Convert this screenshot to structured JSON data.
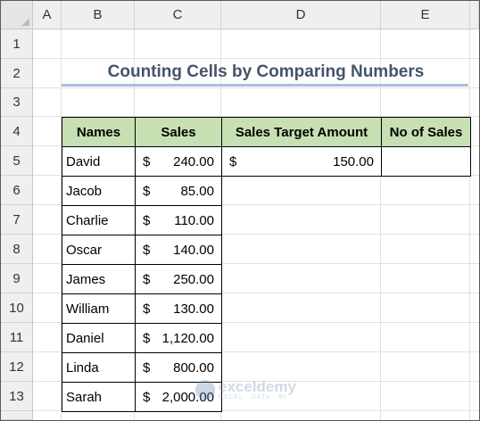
{
  "columns": [
    "A",
    "B",
    "C",
    "D",
    "E"
  ],
  "rows": [
    "1",
    "2",
    "3",
    "4",
    "5",
    "6",
    "7",
    "8",
    "9",
    "10",
    "11",
    "12",
    "13"
  ],
  "title": "Counting Cells by Comparing Numbers",
  "table": {
    "headers": {
      "names": "Names",
      "sales": "Sales",
      "target": "Sales Target Amount",
      "count": "No of Sales"
    },
    "records": [
      {
        "name": "David",
        "currency": "$",
        "amount": "240.00"
      },
      {
        "name": "Jacob",
        "currency": "$",
        "amount": "85.00"
      },
      {
        "name": "Charlie",
        "currency": "$",
        "amount": "110.00"
      },
      {
        "name": "Oscar",
        "currency": "$",
        "amount": "140.00"
      },
      {
        "name": "James",
        "currency": "$",
        "amount": "250.00"
      },
      {
        "name": "William",
        "currency": "$",
        "amount": "130.00"
      },
      {
        "name": "Daniel",
        "currency": "$",
        "amount": "1,120.00"
      },
      {
        "name": "Linda",
        "currency": "$",
        "amount": "800.00"
      },
      {
        "name": "Sarah",
        "currency": "$",
        "amount": "2,000.00"
      }
    ],
    "target_value": {
      "currency": "$",
      "amount": "150.00"
    },
    "count_value": ""
  },
  "watermark": {
    "name": "exceldemy",
    "tagline": "EXCEL · DATA · BI"
  },
  "colors": {
    "header_fill": "#c6e0b4",
    "title_text": "#44546a",
    "title_underline": "#a9bfd9"
  }
}
